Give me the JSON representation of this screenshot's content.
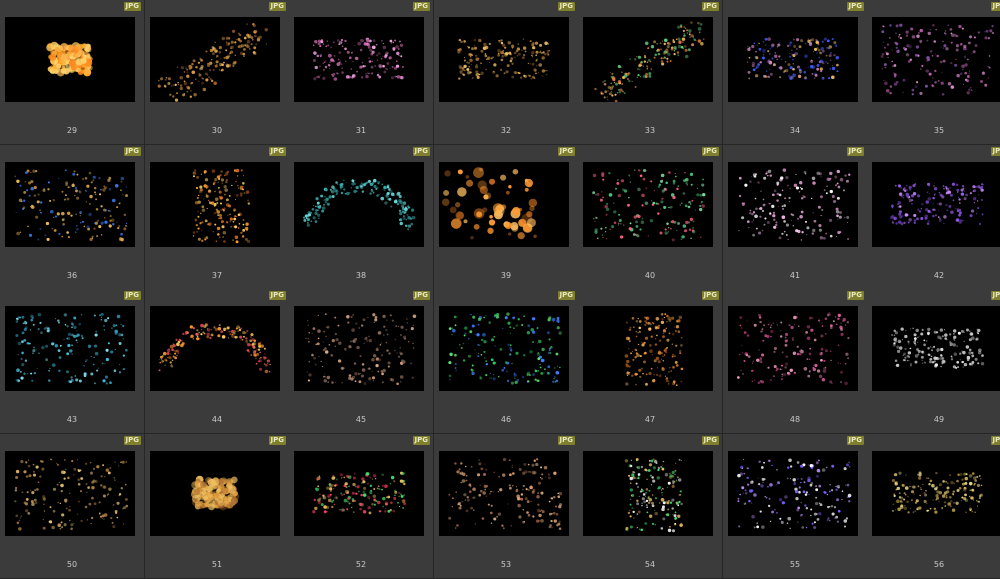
{
  "grid": {
    "badge_label": "JPG",
    "items": [
      {
        "number": "29",
        "palette": [
          "#ffb033",
          "#ffd36b",
          "#ff8a1f"
        ],
        "kind": "cluster"
      },
      {
        "number": "30",
        "palette": [
          "#e0a040",
          "#f5c060",
          "#b07030"
        ],
        "kind": "diag"
      },
      {
        "number": "31",
        "palette": [
          "#e070c0",
          "#f0a0e0",
          "#b06090"
        ],
        "kind": "wide"
      },
      {
        "number": "32",
        "palette": [
          "#d8a040",
          "#f0c060",
          "#a87030"
        ],
        "kind": "wide"
      },
      {
        "number": "33",
        "palette": [
          "#60d080",
          "#f0c060",
          "#e08040"
        ],
        "kind": "diag"
      },
      {
        "number": "34",
        "palette": [
          "#4060ff",
          "#d080c0",
          "#f0c060"
        ],
        "kind": "wide"
      },
      {
        "number": "35",
        "palette": [
          "#c060b0",
          "#e090d0",
          "#8050a0"
        ],
        "kind": "spread"
      },
      {
        "number": "36",
        "palette": [
          "#e0a040",
          "#4080ff",
          "#f0c060"
        ],
        "kind": "spread"
      },
      {
        "number": "37",
        "palette": [
          "#ffa030",
          "#ffd060",
          "#e07020"
        ],
        "kind": "tall"
      },
      {
        "number": "38",
        "palette": [
          "#40c0c0",
          "#70e0e0",
          "#30a0a0"
        ],
        "kind": "arc"
      },
      {
        "number": "39",
        "palette": [
          "#ff9a30",
          "#ffc060",
          "#d07020"
        ],
        "kind": "big"
      },
      {
        "number": "40",
        "palette": [
          "#50d080",
          "#ff6080",
          "#80e0a0"
        ],
        "kind": "spread"
      },
      {
        "number": "41",
        "palette": [
          "#f0b0e0",
          "#ffffff",
          "#d090c0"
        ],
        "kind": "spread"
      },
      {
        "number": "42",
        "palette": [
          "#a060ff",
          "#d090ff",
          "#7040c0"
        ],
        "kind": "wide"
      },
      {
        "number": "43",
        "palette": [
          "#40c0e0",
          "#80e0f0",
          "#3090b0"
        ],
        "kind": "spread"
      },
      {
        "number": "44",
        "palette": [
          "#ff9a30",
          "#ff5060",
          "#ffd060"
        ],
        "kind": "arc"
      },
      {
        "number": "45",
        "palette": [
          "#c09070",
          "#e0b090",
          "#806050"
        ],
        "kind": "spread"
      },
      {
        "number": "46",
        "palette": [
          "#30d060",
          "#60f080",
          "#4080ff"
        ],
        "kind": "spread"
      },
      {
        "number": "47",
        "palette": [
          "#ff9a30",
          "#ffc060",
          "#d07020"
        ],
        "kind": "tall"
      },
      {
        "number": "48",
        "palette": [
          "#e060a0",
          "#f0a0c0",
          "#c04080"
        ],
        "kind": "spread"
      },
      {
        "number": "49",
        "palette": [
          "#ffffff",
          "#c0c0c0",
          "#e0e0e0"
        ],
        "kind": "wide"
      },
      {
        "number": "50",
        "palette": [
          "#e0b060",
          "#f0d080",
          "#b08040"
        ],
        "kind": "spread"
      },
      {
        "number": "51",
        "palette": [
          "#e0a040",
          "#f0c060",
          "#b07030"
        ],
        "kind": "cluster"
      },
      {
        "number": "52",
        "palette": [
          "#ff4060",
          "#40e070",
          "#f0c060"
        ],
        "kind": "wide"
      },
      {
        "number": "53",
        "palette": [
          "#e0a070",
          "#f0c090",
          "#b07050"
        ],
        "kind": "spread"
      },
      {
        "number": "54",
        "palette": [
          "#f0c060",
          "#40e070",
          "#ffffff"
        ],
        "kind": "tall"
      },
      {
        "number": "55",
        "palette": [
          "#8060ff",
          "#c090ff",
          "#ffffff"
        ],
        "kind": "spread"
      },
      {
        "number": "56",
        "palette": [
          "#e0c060",
          "#f0e090",
          "#b09040"
        ],
        "kind": "wide"
      }
    ]
  }
}
